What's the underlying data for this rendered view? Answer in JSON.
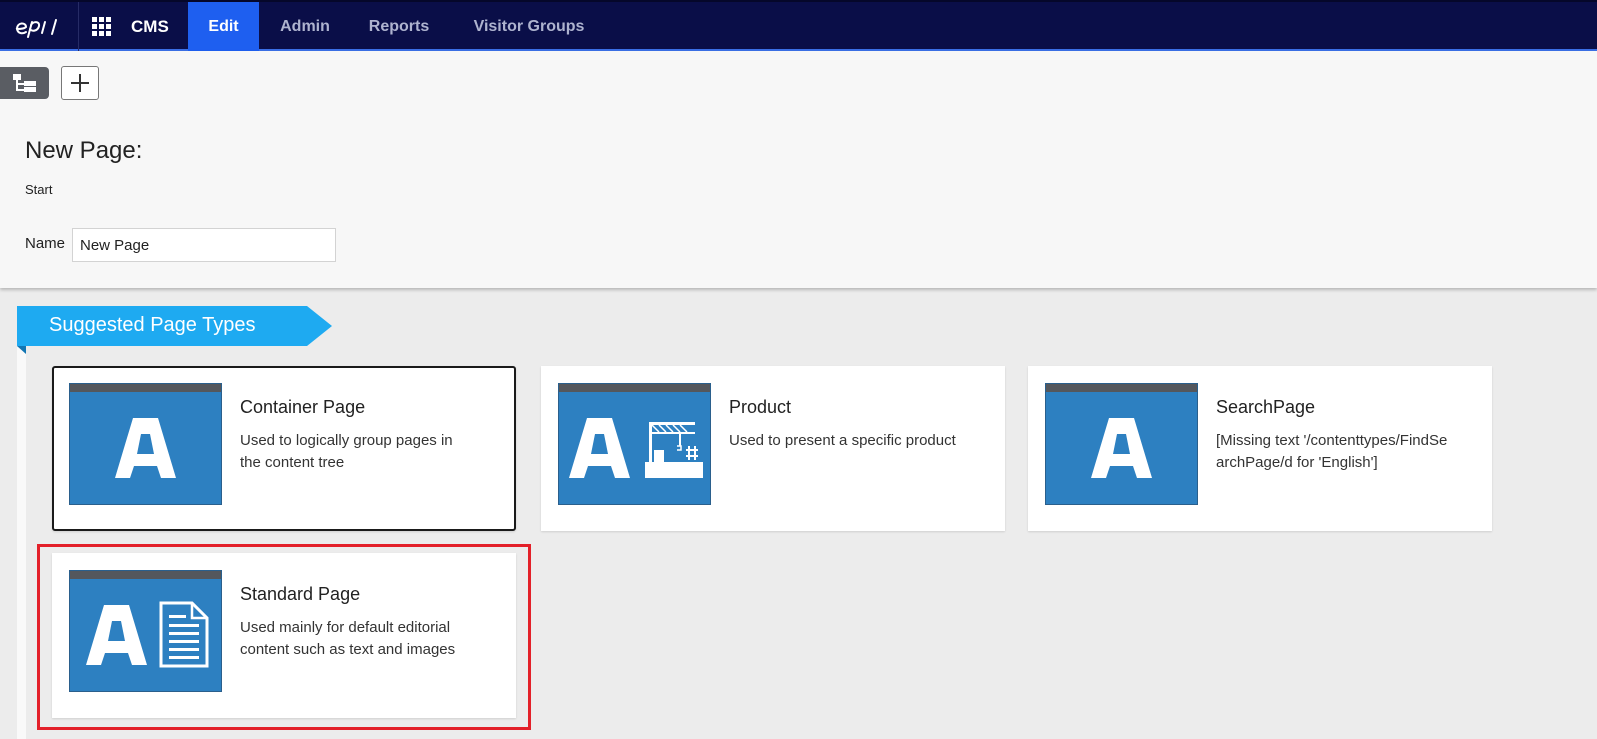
{
  "topbar": {
    "app_label": "CMS",
    "tabs": [
      {
        "label": "Edit",
        "active": true
      },
      {
        "label": "Admin",
        "active": false
      },
      {
        "label": "Reports",
        "active": false
      },
      {
        "label": "Visitor Groups",
        "active": false
      }
    ],
    "icons": {
      "logo": "episerver-logo",
      "apps": "app-grid-icon"
    },
    "colors": {
      "bar": "#0a0e48",
      "active_tab": "#1e5ff0"
    }
  },
  "toolbar": {
    "icons": {
      "tree_toggle": "page-tree-icon",
      "add": "plus-icon"
    }
  },
  "form": {
    "heading": "New Page:",
    "breadcrumb": "Start",
    "name_label": "Name",
    "name_value": "New Page"
  },
  "suggested": {
    "section_title": "Suggested Page Types",
    "accent_color": "#1eaaf1",
    "cards": [
      {
        "title": "Container Page",
        "description": "Used to logically group pages in the content tree",
        "icon": "letter-a-icon",
        "selected": true
      },
      {
        "title": "Product",
        "description": "Used to present a specific product",
        "icon": "letter-a-factory-icon",
        "selected": false
      },
      {
        "title": "SearchPage",
        "description": "[Missing text '/contenttypes/FindSearchPage/d for 'English']",
        "icon": "letter-a-icon",
        "selected": false
      },
      {
        "title": "Standard Page",
        "description": "Used mainly for default editorial content such as text and images",
        "icon": "letter-a-document-icon",
        "selected": false,
        "highlighted": true
      }
    ]
  }
}
